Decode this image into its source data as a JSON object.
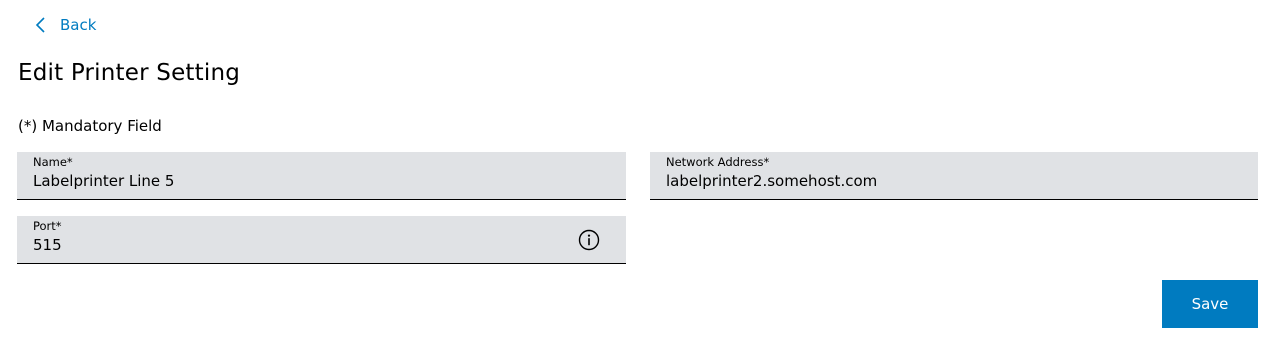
{
  "nav": {
    "back_label": "Back",
    "back_icon": "chevron-left-icon"
  },
  "page": {
    "title": "Edit Printer Setting",
    "mandatory_note": "(*) Mandatory Field"
  },
  "form": {
    "name": {
      "label": "Name*",
      "value": "Labelprinter Line 5"
    },
    "network_address": {
      "label": "Network Address*",
      "value": "labelprinter2.somehost.com"
    },
    "port": {
      "label": "Port*",
      "value": "515",
      "icon": "info-icon"
    }
  },
  "actions": {
    "save_label": "Save"
  },
  "colors": {
    "accent": "#007bc0",
    "field_background": "#e0e2e5",
    "text": "#000000"
  }
}
